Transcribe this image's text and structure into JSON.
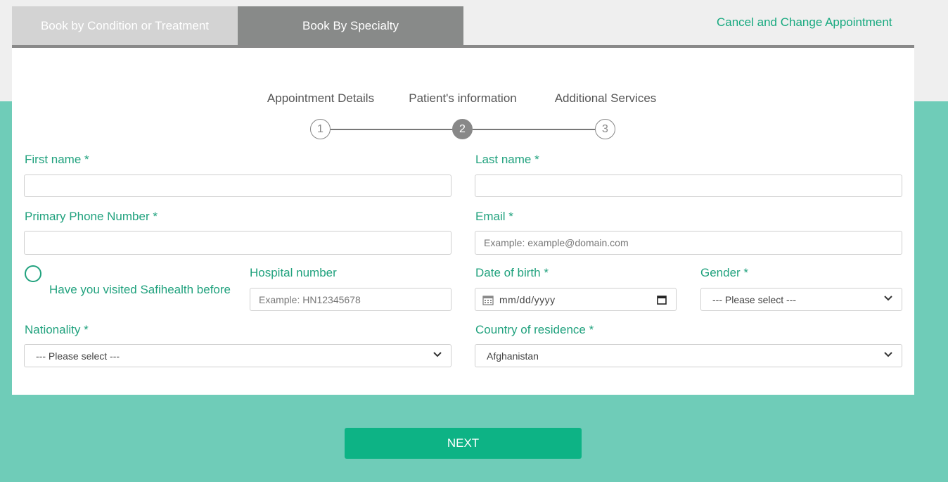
{
  "tabs": [
    {
      "label": "Book by Condition or Treatment"
    },
    {
      "label": "Book By Specialty"
    }
  ],
  "cancel_link": "Cancel and Change Appointment",
  "steps": [
    {
      "label": "Appointment Details",
      "number": "1"
    },
    {
      "label": "Patient's information",
      "number": "2"
    },
    {
      "label": "Additional Services",
      "number": "3"
    }
  ],
  "form": {
    "first_name": {
      "label": "First name *",
      "value": ""
    },
    "last_name": {
      "label": "Last name *",
      "value": ""
    },
    "phone": {
      "label": "Primary Phone Number *",
      "value": ""
    },
    "email": {
      "label": "Email *",
      "placeholder": "Example: example@domain.com"
    },
    "visited": {
      "label": "Have you visited Safihealth before"
    },
    "hospital_number": {
      "label": "Hospital number",
      "placeholder": "Example: HN12345678"
    },
    "dob": {
      "label": "Date of birth *",
      "value": "mm/dd/yyyy"
    },
    "gender": {
      "label": "Gender *",
      "value": "--- Please select ---"
    },
    "nationality": {
      "label": "Nationality *",
      "value": "--- Please select ---"
    },
    "country": {
      "label": "Country of residence *",
      "value": "Afghanistan"
    }
  },
  "next_button": "NEXT",
  "colors": {
    "accent": "#21a27e",
    "button": "#0db385",
    "background": "#6fccb8"
  }
}
